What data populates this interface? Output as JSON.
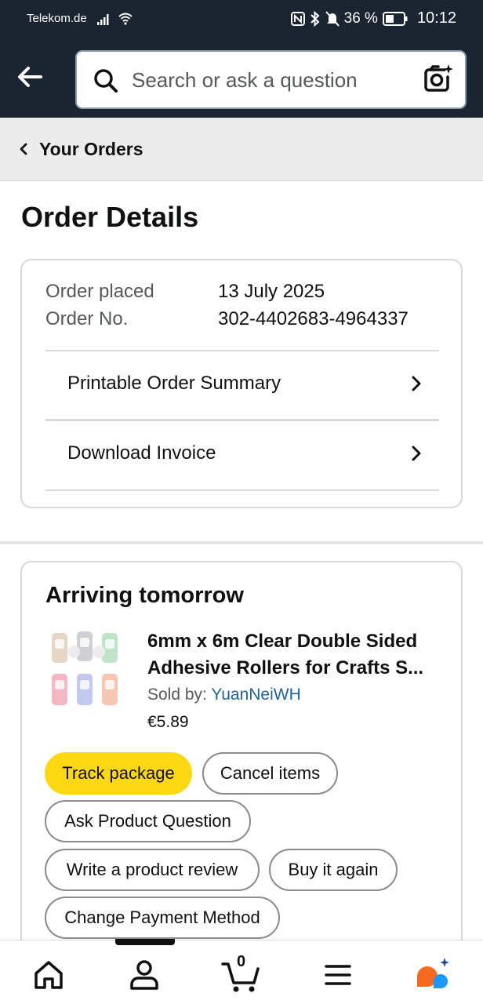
{
  "status_bar": {
    "carrier": "Telekom.de",
    "battery": "36 %",
    "time": "10:12"
  },
  "search": {
    "placeholder": "Search or ask a question"
  },
  "breadcrumb": {
    "label": "Your Orders"
  },
  "page_title": "Order Details",
  "order": {
    "placed_label": "Order placed",
    "placed_value": "13 July 2025",
    "number_label": "Order No.",
    "number_value": "302-4402683-4964337",
    "links": [
      {
        "label": "Printable Order Summary"
      },
      {
        "label": "Download Invoice"
      }
    ]
  },
  "shipment": {
    "status": "Arriving tomorrow",
    "product": {
      "title_line1": "6mm x 6m Clear Double Sided",
      "title_line2": "Adhesive Rollers for Crafts S...",
      "sold_by_label": "Sold by:",
      "seller": "YuanNeiWH",
      "price": "€5.89"
    },
    "actions": {
      "track": "Track package",
      "cancel": "Cancel items",
      "ask": "Ask Product Question",
      "review": "Write a product review",
      "buy_again": "Buy it again",
      "change_payment": "Change Payment Method"
    }
  },
  "bottom_nav": {
    "cart_count": "0",
    "items": [
      "home-icon",
      "account-icon",
      "cart-icon",
      "menu-icon",
      "rufus-ai-icon"
    ]
  },
  "colors": {
    "header_bg": "#1b2431",
    "primary_button": "#ffd814",
    "link_blue": "#2162a1",
    "ai_orange": "#f56a1e",
    "ai_blue": "#1a98ff"
  }
}
